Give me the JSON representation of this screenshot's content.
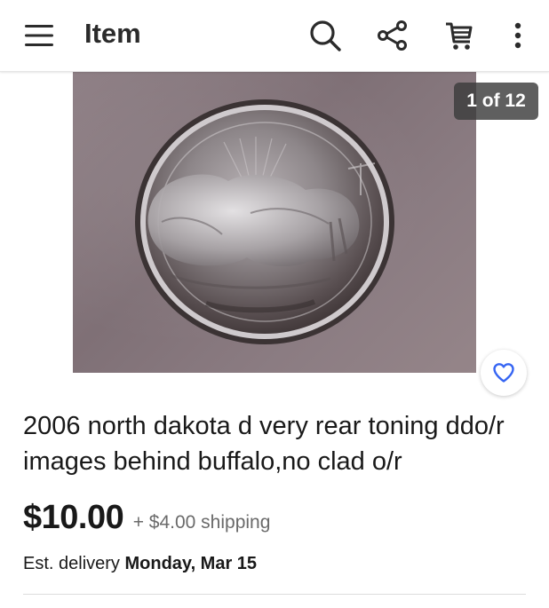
{
  "app_bar": {
    "title": "Item",
    "icons": {
      "menu": "hamburger-menu-icon",
      "search": "search-icon",
      "share": "share-icon",
      "cart": "cart-icon",
      "more": "more-vertical-icon"
    }
  },
  "gallery": {
    "counter": "1 of 12",
    "watch_icon": "heart-icon"
  },
  "listing": {
    "title": "2006 north dakota d very rear toning ddo/r images behind buffalo,no clad o/r",
    "price": "$10.00",
    "shipping": "+ $4.00 shipping",
    "delivery_label": "Est. delivery",
    "delivery_date": "Monday, Mar 15"
  },
  "colors": {
    "text": "#191919",
    "secondary_text": "#6a6a6a",
    "accent": "#3665f3"
  }
}
